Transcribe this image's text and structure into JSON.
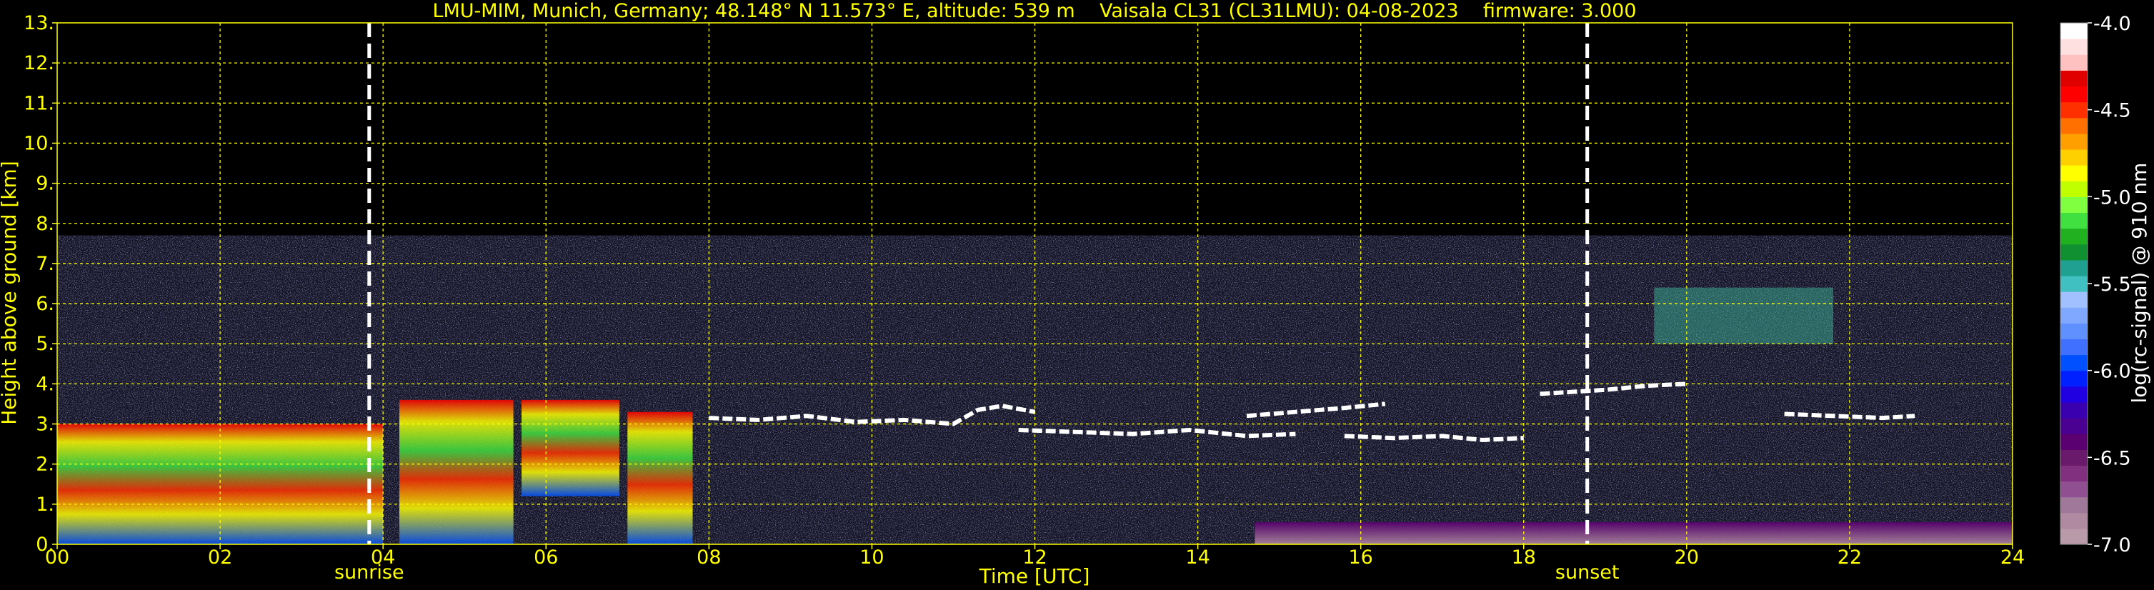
{
  "chart_data": {
    "type": "heatmap",
    "title": "LMU-MIM, Munich, Germany; 48.148° N 11.573° E, altitude: 539 m    Vaisala CL31 (CL31LMU): 04-08-2023    firmware: 3.000",
    "xlabel": "Time [UTC]",
    "ylabel": "Height above ground [km]",
    "xlim": [
      0,
      24
    ],
    "ylim": [
      0,
      13
    ],
    "x_ticks": [
      {
        "value": 0,
        "label": "00"
      },
      {
        "value": 2,
        "label": "02"
      },
      {
        "value": 4,
        "label": "04"
      },
      {
        "value": 6,
        "label": "06"
      },
      {
        "value": 8,
        "label": "08"
      },
      {
        "value": 10,
        "label": "10"
      },
      {
        "value": 12,
        "label": "12"
      },
      {
        "value": 14,
        "label": "14"
      },
      {
        "value": 16,
        "label": "16"
      },
      {
        "value": 18,
        "label": "18"
      },
      {
        "value": 20,
        "label": "20"
      },
      {
        "value": 22,
        "label": "22"
      },
      {
        "value": 24,
        "label": "24"
      }
    ],
    "y_ticks": [
      {
        "value": 0,
        "label": "0."
      },
      {
        "value": 1,
        "label": "1."
      },
      {
        "value": 2,
        "label": "2."
      },
      {
        "value": 3,
        "label": "3."
      },
      {
        "value": 4,
        "label": "4."
      },
      {
        "value": 5,
        "label": "5."
      },
      {
        "value": 6,
        "label": "6."
      },
      {
        "value": 7,
        "label": "7."
      },
      {
        "value": 8,
        "label": "8."
      },
      {
        "value": 9,
        "label": "9."
      },
      {
        "value": 10,
        "label": "10."
      },
      {
        "value": 11,
        "label": "11."
      },
      {
        "value": 12,
        "label": "12."
      },
      {
        "value": 13,
        "label": "13."
      }
    ],
    "grid": true,
    "markers": [
      {
        "label": "sunrise",
        "time": 3.83
      },
      {
        "label": "sunset",
        "time": 18.78
      }
    ],
    "signal_ceiling_km": 7.7,
    "cloud_layers": [
      {
        "t": [
          8.0,
          8.6,
          9.2,
          9.8,
          10.4,
          11.0,
          11.3,
          11.6,
          12.0
        ],
        "h": [
          3.15,
          3.1,
          3.2,
          3.05,
          3.1,
          3.0,
          3.35,
          3.45,
          3.3
        ]
      },
      {
        "t": [
          11.8,
          12.5,
          13.2,
          13.9,
          14.6,
          15.2
        ],
        "h": [
          2.85,
          2.8,
          2.75,
          2.85,
          2.7,
          2.75
        ]
      },
      {
        "t": [
          15.8,
          16.4,
          17.0,
          17.5,
          18.0
        ],
        "h": [
          2.7,
          2.65,
          2.7,
          2.6,
          2.65
        ]
      },
      {
        "t": [
          14.6,
          15.2,
          15.8,
          16.3
        ],
        "h": [
          3.2,
          3.3,
          3.4,
          3.5
        ]
      },
      {
        "t": [
          18.2,
          18.6,
          19.0,
          19.5,
          20.0
        ],
        "h": [
          3.75,
          3.8,
          3.85,
          3.95,
          4.0
        ]
      },
      {
        "t": [
          21.2,
          21.8,
          22.4,
          22.8
        ],
        "h": [
          3.25,
          3.2,
          3.15,
          3.2
        ]
      }
    ],
    "colorbar": {
      "label": "log(rc-signal) @ 910 nm",
      "range": [
        -7.0,
        -4.0
      ],
      "ticks": [
        {
          "value": -4.0,
          "label": "-4.0"
        },
        {
          "value": -4.5,
          "label": "-4.5"
        },
        {
          "value": -5.0,
          "label": "-5.0"
        },
        {
          "value": -5.5,
          "label": "-5.5"
        },
        {
          "value": -6.0,
          "label": "-6.0"
        },
        {
          "value": -6.5,
          "label": "-6.5"
        },
        {
          "value": -7.0,
          "label": "-7.0"
        }
      ],
      "colors": [
        "#b89aa8",
        "#b08aa0",
        "#a0789a",
        "#904f90",
        "#80307f",
        "#6a1a6a",
        "#5a0070",
        "#4a0090",
        "#3a00b0",
        "#2000e0",
        "#0020ff",
        "#0050ff",
        "#4070ff",
        "#6090ff",
        "#80a8ff",
        "#a0c0ff",
        "#40c0c0",
        "#20a090",
        "#109030",
        "#20b020",
        "#40e040",
        "#80ff40",
        "#c0ff00",
        "#ffff00",
        "#ffd000",
        "#ffa000",
        "#ff7000",
        "#ff3000",
        "#ff0000",
        "#e00000",
        "#ffc0c0",
        "#ffe0e0",
        "#ffffff"
      ]
    }
  }
}
